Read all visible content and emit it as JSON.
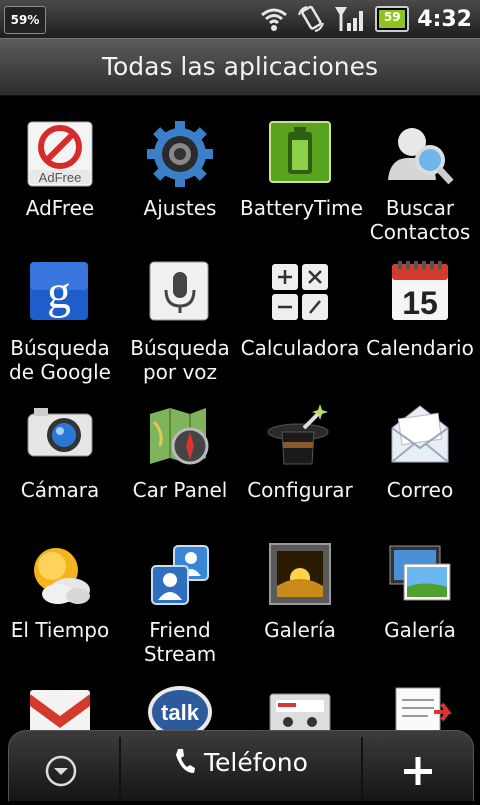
{
  "status_bar": {
    "battery_left": "59%",
    "battery_right": "59",
    "time": "4:32",
    "icons": [
      "wifi-icon",
      "rotation-icon",
      "signal-icon",
      "battery-icon"
    ]
  },
  "header": {
    "title": "Todas las aplicaciones"
  },
  "apps": [
    {
      "label": "AdFree",
      "icon": "adfree-icon"
    },
    {
      "label": "Ajustes",
      "icon": "gear-icon"
    },
    {
      "label": "BatteryTime",
      "icon": "battery-app-icon"
    },
    {
      "label": "Buscar Contactos",
      "icon": "contacts-search-icon"
    },
    {
      "label": "Búsqueda de Google",
      "icon": "google-icon"
    },
    {
      "label": "Búsqueda por voz",
      "icon": "microphone-icon"
    },
    {
      "label": "Calculadora",
      "icon": "calculator-icon"
    },
    {
      "label": "Calendario",
      "icon": "calendar-icon"
    },
    {
      "label": "Cámara",
      "icon": "camera-icon"
    },
    {
      "label": "Car Panel",
      "icon": "car-panel-icon"
    },
    {
      "label": "Configurar",
      "icon": "magic-hat-icon"
    },
    {
      "label": "Correo",
      "icon": "mail-icon"
    },
    {
      "label": "El Tiempo",
      "icon": "weather-icon"
    },
    {
      "label": "Friend Stream",
      "icon": "friend-stream-icon"
    },
    {
      "label": "Galería",
      "icon": "gallery-icon"
    },
    {
      "label": "Galería",
      "icon": "gallery-alt-icon"
    }
  ],
  "calendar_day": "15",
  "partial_apps": [
    "gmail-icon",
    "talk-icon",
    "cassette-icon",
    "notes-icon"
  ],
  "talk_text": "talk",
  "dock": {
    "phone_label": "Teléfono",
    "left_icon": "collapse-icon",
    "right_icon": "add-icon"
  }
}
